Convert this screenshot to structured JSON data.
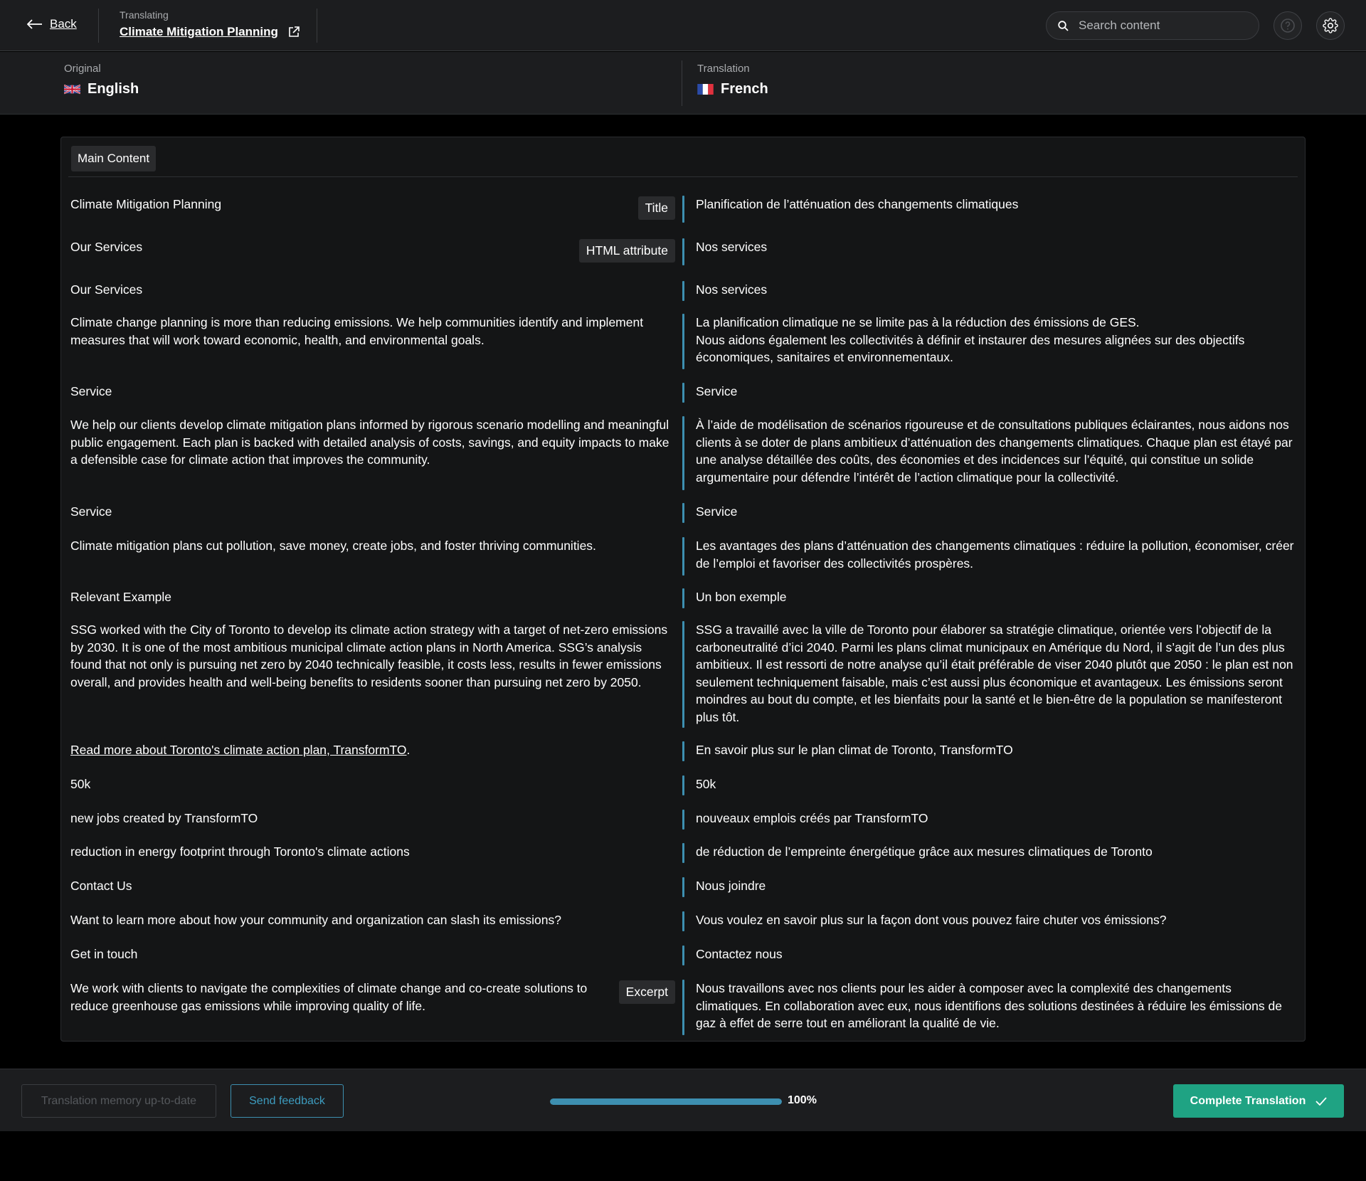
{
  "header": {
    "back_label": "Back",
    "translating_label": "Translating",
    "page_title": "Climate Mitigation Planning",
    "search_placeholder": "Search content"
  },
  "languages": {
    "original_label": "Original",
    "original_name": "English",
    "translation_label": "Translation",
    "translation_name": "French"
  },
  "section": {
    "title": "Main Content"
  },
  "rows": [
    {
      "source": "Climate Mitigation Planning",
      "tag": "Title",
      "target": "Planification de l’atténuation des changements climatiques"
    },
    {
      "source": "Our Services",
      "tag": "HTML attribute",
      "target": "Nos services"
    },
    {
      "source": "Our Services",
      "target": "Nos services"
    },
    {
      "source": "Climate change planning is more than reducing emissions. We help communities identify and implement measures that will work toward economic, health, and environmental goals.",
      "target_line1": "La planification climatique ne se limite pas à la réduction des émissions de GES.",
      "target_line2": "Nous aidons également les collectivités à définir et instaurer des mesures alignées sur des objectifs économiques, sanitaires et environnementaux."
    },
    {
      "source": "Service",
      "target": "Service"
    },
    {
      "source": "We help our clients develop climate mitigation plans informed by rigorous scenario modelling and meaningful public engagement. Each plan is backed with detailed analysis of costs, savings, and equity impacts to make a defensible case for climate action that improves the community.",
      "target": "À l’aide de modélisation de scénarios rigoureuse et de consultations publiques éclairantes, nous aidons nos clients à se doter de plans ambitieux d’atténuation des changements climatiques. Chaque plan est étayé par une analyse détaillée des coûts, des économies et des incidences sur l’équité, qui constitue un solide argumentaire pour défendre l’intérêt de l’action climatique pour la collectivité."
    },
    {
      "source": "Service",
      "target": "Service"
    },
    {
      "source": "Climate mitigation plans cut pollution, save money, create jobs, and foster thriving communities.",
      "target": "Les avantages des plans d’atténuation des changements climatiques : réduire la pollution, économiser, créer de l’emploi et favoriser des collectivités prospères."
    },
    {
      "source": "Relevant Example",
      "target": "Un bon exemple"
    },
    {
      "source": "SSG worked with the City of Toronto to develop its climate action strategy with a target of net-zero emissions by 2030. It is one of the most ambitious municipal climate action plans in North America. SSG’s analysis found that not only is pursuing net zero by 2040 technically feasible, it costs less, results in fewer emissions overall, and provides health and well-being benefits to residents sooner than pursuing net zero by 2050.",
      "target": "SSG a travaillé avec la ville de Toronto pour élaborer sa stratégie climatique, orientée vers l’objectif de la carboneutralité d’ici 2040. Parmi les plans climat municipaux en Amérique du Nord, il s’agit de l’un des plus ambitieux. Il est ressorti de notre analyse qu’il était préférable de viser 2040 plutôt que 2050 : le plan est non seulement techniquement faisable, mais c’est aussi plus économique et avantageux. Les émissions seront moindres au bout du compte, et les bienfaits pour la santé et le bien-être de la population se manifesteront plus tôt."
    },
    {
      "source_link": "Read more about Toronto's climate action plan, TransformTO",
      "source_suffix": ".",
      "target": "En savoir plus sur le plan climat de Toronto, TransformTO"
    },
    {
      "source": "50k",
      "target": "50k"
    },
    {
      "source": "new jobs created by TransformTO",
      "target": "nouveaux emplois créés par TransformTO"
    },
    {
      "source": "reduction in energy footprint through Toronto's climate actions",
      "target": "de réduction de l’empreinte énergétique grâce aux mesures climatiques de Toronto"
    },
    {
      "source": "Contact Us",
      "target": "Nous joindre"
    },
    {
      "source": "Want to learn more about how your community and organization can slash its emissions?",
      "target": "Vous voulez en savoir plus sur la façon dont vous pouvez faire chuter vos émissions?"
    },
    {
      "source": "Get in touch",
      "target": "Contactez nous"
    },
    {
      "source": "We work with clients to navigate the complexities of climate change and co-create solutions to reduce greenhouse gas emissions while improving quality of life.",
      "tag": "Excerpt",
      "target": "Nous travaillons avec nos clients pour les aider à composer avec la complexité des changements climatiques. En collaboration avec eux, nous identifions des solutions destinées à réduire les émissions de gaz à effet de serre tout en améliorant la qualité de vie."
    }
  ],
  "footer": {
    "memory_label": "Translation memory up-to-date",
    "feedback_label": "Send feedback",
    "progress_value": 1.0,
    "progress_text": "100%",
    "complete_label": "Complete Translation"
  },
  "colors": {
    "accent": "#3d8fb0",
    "complete": "#1fa383",
    "background": "#1c1d1f"
  },
  "icons": [
    "arrow-left-icon",
    "external-link-icon",
    "search-icon",
    "help-icon",
    "gear-icon",
    "uk-flag-icon",
    "fr-flag-icon",
    "check-icon"
  ]
}
